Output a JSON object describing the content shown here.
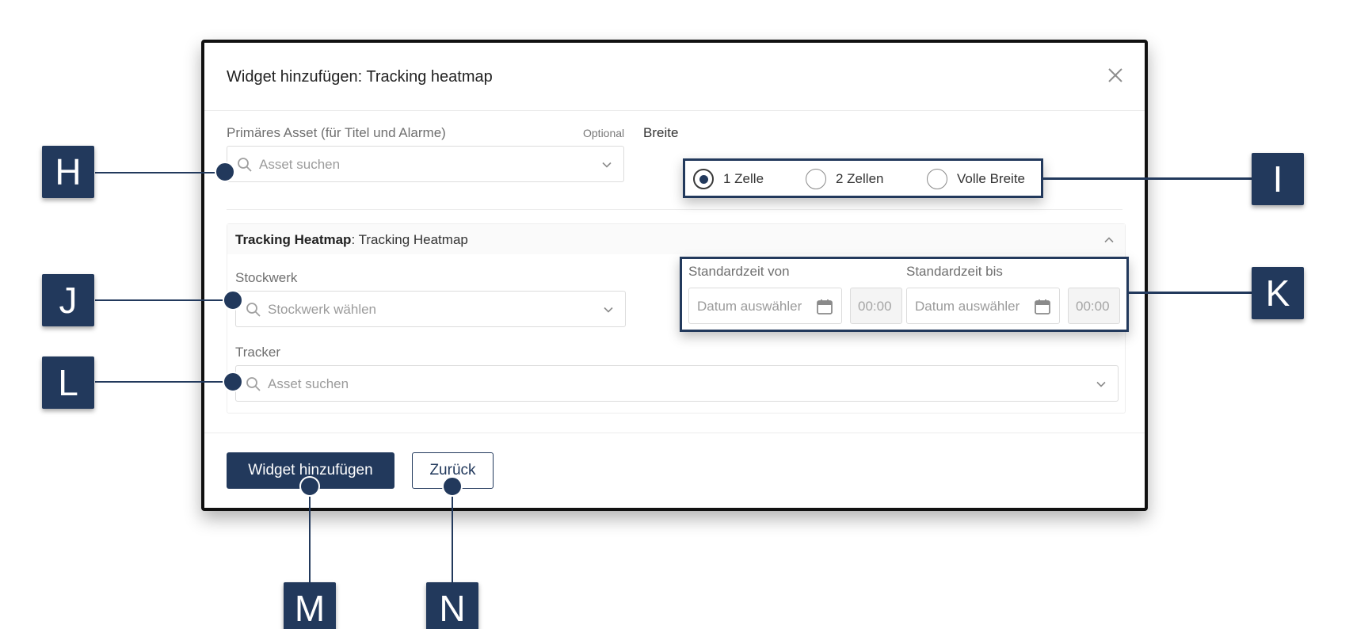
{
  "dialog": {
    "title": "Widget hinzufügen: Tracking heatmap"
  },
  "primary_asset": {
    "label": "Primäres Asset (für Titel und Alarme)",
    "optional": "Optional",
    "placeholder": "Asset suchen"
  },
  "width": {
    "label": "Breite",
    "options": [
      {
        "label": "1 Zelle",
        "checked": true
      },
      {
        "label": "2 Zellen",
        "checked": false
      },
      {
        "label": "Volle Breite",
        "checked": false
      }
    ]
  },
  "section": {
    "title_bold": "Tracking Heatmap",
    "title_rest": ": Tracking Heatmap"
  },
  "floor": {
    "label": "Stockwerk",
    "placeholder": "Stockwerk wählen"
  },
  "default_time": {
    "from_label": "Standardzeit von",
    "to_label": "Standardzeit bis",
    "from_date_placeholder": "Datum auswähler",
    "from_time_placeholder": "00:00",
    "to_date_placeholder": "Datum auswähler",
    "to_time_placeholder": "00:00"
  },
  "tracker": {
    "label": "Tracker",
    "placeholder": "Asset suchen"
  },
  "buttons": {
    "add": "Widget hinzufügen",
    "back": "Zurück"
  },
  "callouts": {
    "h": "H",
    "i": "I",
    "j": "J",
    "k": "K",
    "l": "L",
    "m": "M",
    "n": "N"
  },
  "colors": {
    "accent": "#22395c",
    "border": "#dcdcdc",
    "placeholder": "#9b9b9b"
  }
}
